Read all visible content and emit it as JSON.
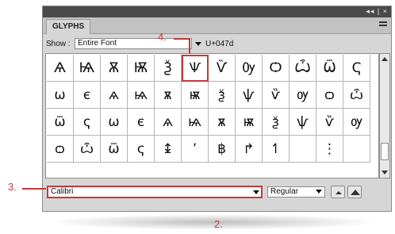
{
  "panel": {
    "title_controls": "◂◂ | ×",
    "tab_label": "GLYPHS",
    "show_label": "Show :",
    "show_value": "Entire Font",
    "unicode_label": "U+047d",
    "font_family": "Calibri",
    "font_style": "Regular"
  },
  "glyphs": [
    [
      "Ѧ",
      "Ѩ",
      "Ѫ",
      "Ѭ",
      "Ѯ",
      "Ѱ",
      "Ѷ",
      "Ѹ",
      "Ѻ",
      "Ѽ",
      "Ѿ",
      "Ҁ"
    ],
    [
      "ѡ",
      "є",
      "ѧ",
      "ѩ",
      "ѫ",
      "ѭ",
      "ѯ",
      "ѱ",
      "ѷ",
      "ѹ",
      "ѻ",
      "ѽ"
    ],
    [
      "ѿ",
      "ҁ",
      "ѡ",
      "є",
      "ѧ",
      "ѩ",
      "ѫ",
      "ѭ",
      "ѯ",
      "ѱ",
      "ѷ",
      "ѹ"
    ],
    [
      "ѻ",
      "ѽ",
      "ѿ",
      "ҁ",
      "↨",
      "ʼ",
      "฿",
      "↱",
      "↿",
      "",
      "⋮",
      ""
    ]
  ],
  "callouts": {
    "c2": "2.",
    "c3": "3.",
    "c4": "4."
  },
  "colors": {
    "highlight": "#c23a3a",
    "panel_bg": "#d6d6d6",
    "title_bar": "#4a4a4a"
  }
}
